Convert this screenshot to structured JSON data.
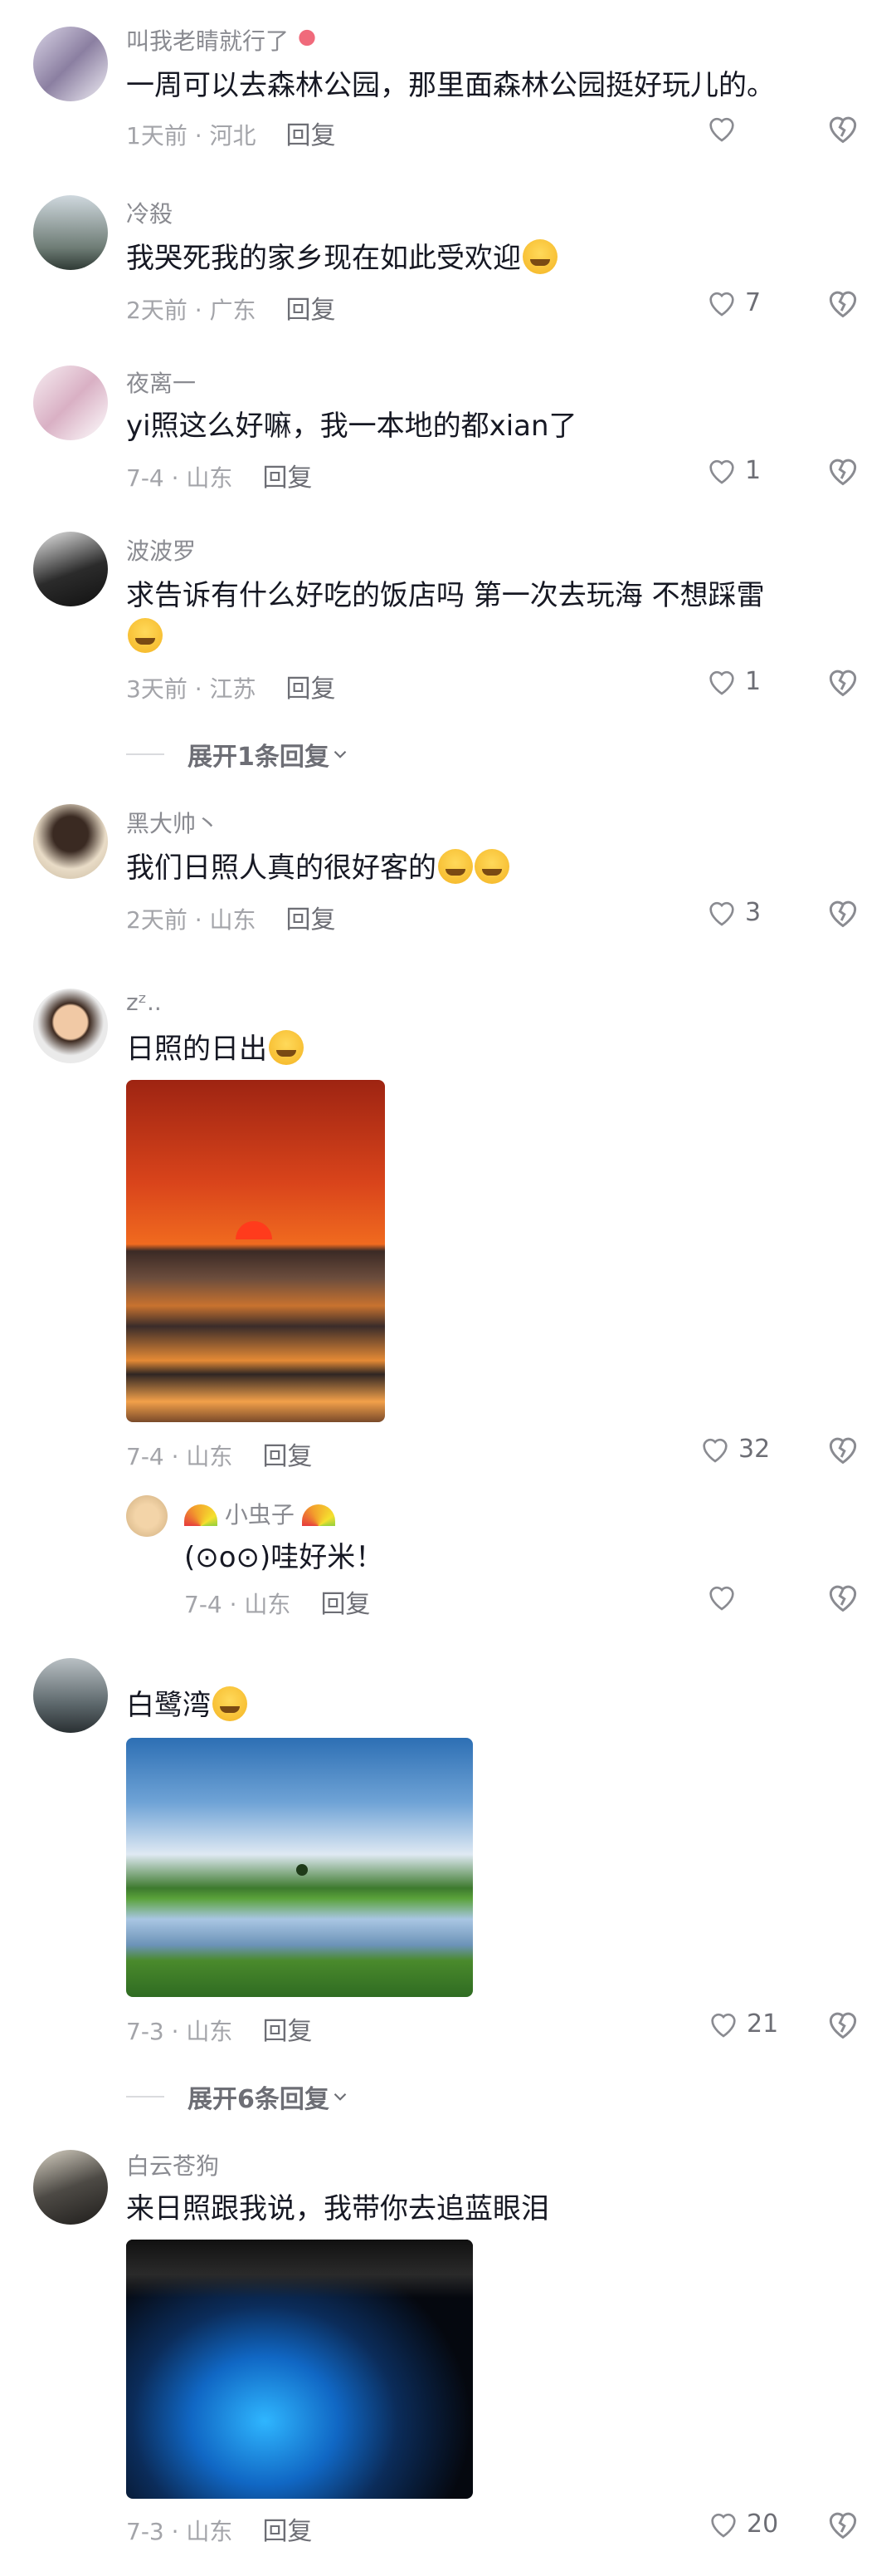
{
  "comments": [
    {
      "user": "叫我老睛就行了",
      "text": "一周可以去森林公园，那里面森林公园挺好玩儿的。",
      "time": "1天前 · 河北",
      "reply": "回复",
      "likes": ""
    },
    {
      "user": "冷殺",
      "text": "我哭死我的家乡现在如此受欢迎",
      "time": "2天前 · 广东",
      "reply": "回复",
      "likes": "7"
    },
    {
      "user": "夜离一",
      "text": "yi照这么好嘛，我一本地的都xian了",
      "time": "7-4 · 山东",
      "reply": "回复",
      "likes": "1"
    },
    {
      "user": "波波罗",
      "text": "求告诉有什么好吃的饭店吗 第一次去玩海 不想踩雷",
      "time": "3天前 · 江苏",
      "reply": "回复",
      "likes": "1",
      "expand": "展开1条回复"
    },
    {
      "user": "黑大帅丶",
      "text": "我们日照人真的很好客的",
      "time": "2天前 · 山东",
      "reply": "回复",
      "likes": "3"
    },
    {
      "user": "zᶻ..",
      "text": "日照的日出",
      "time": "7-4 · 山东",
      "reply": "回复",
      "likes": "32"
    },
    {
      "user": "小虫子",
      "text": "(⊙o⊙)哇好米！",
      "time": "7-4 · 山东",
      "reply": "回复",
      "likes": ""
    },
    {
      "user": "",
      "text": "白鹭湾",
      "time": "7-3 · 山东",
      "reply": "回复",
      "likes": "21",
      "expand": "展开6条回复"
    },
    {
      "user": "白云苍狗",
      "text": "来日照跟我说，我带你去追蓝眼泪",
      "time": "7-3 · 山东",
      "reply": "回复",
      "likes": "20"
    }
  ],
  "colors": {
    "text": "#161823",
    "muted": "#8a8b91"
  }
}
